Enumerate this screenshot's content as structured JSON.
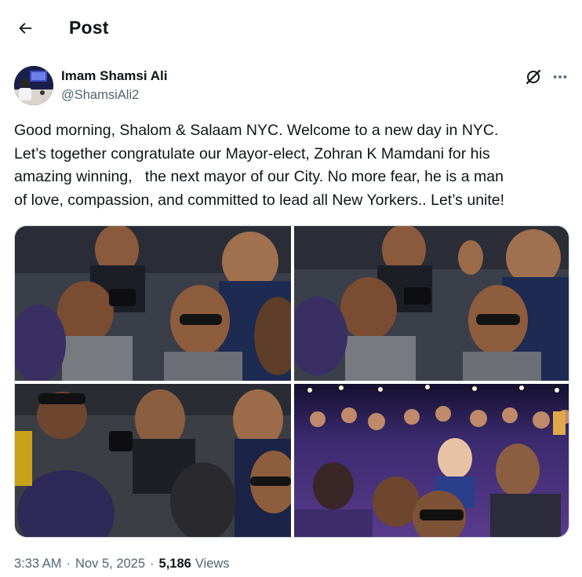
{
  "header": {
    "back_icon": "arrow-left-icon",
    "title": "Post"
  },
  "author": {
    "name": "Imam Shamsi Ali",
    "handle": "@ShamsiAli2",
    "grok_icon": "grok-slash-icon",
    "more_icon": "more-horizontal-icon"
  },
  "post": {
    "text": "Good morning, Shalom & Salaam NYC. Welcome to a new day in NYC.\nLet’s together congratulate our Mayor-elect, Zohran K Mamdani for his\namazing winning,   the next mayor of our City. No more fear, he is a man\nof love, compassion, and committed to lead all New Yorkers.. Let’s unite!"
  },
  "media": {
    "photo_count": 4
  },
  "meta": {
    "time": "3:33 AM",
    "date": "Nov 5, 2025",
    "separator": "·",
    "views_count": "5,186",
    "views_label": "Views"
  },
  "colors": {
    "text_primary": "#0f1419",
    "text_secondary": "#536471",
    "border": "#cfd9de"
  }
}
